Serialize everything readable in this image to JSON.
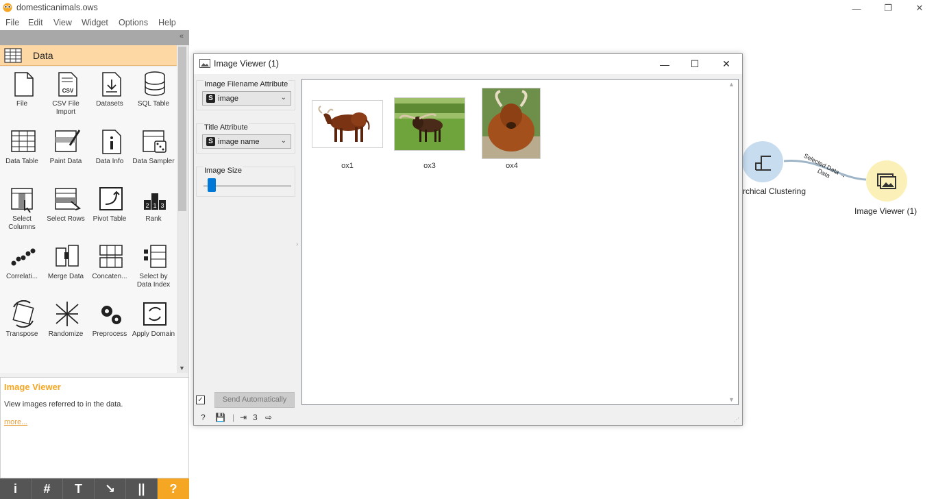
{
  "app": {
    "window_title": "domesticanimals.ows",
    "menu": [
      "File",
      "Edit",
      "View",
      "Widget",
      "Options",
      "Help"
    ]
  },
  "sidebar": {
    "category": "Data",
    "collapse_glyph": "«",
    "widgets": [
      {
        "label": "File",
        "icon": "file-icon"
      },
      {
        "label": "CSV File Import",
        "icon": "csv-file-icon"
      },
      {
        "label": "Datasets",
        "icon": "datasets-icon"
      },
      {
        "label": "SQL Table",
        "icon": "sql-table-icon"
      },
      {
        "label": "Data Table",
        "icon": "data-table-icon"
      },
      {
        "label": "Paint Data",
        "icon": "paint-data-icon"
      },
      {
        "label": "Data Info",
        "icon": "data-info-icon"
      },
      {
        "label": "Data Sampler",
        "icon": "data-sampler-icon"
      },
      {
        "label": "Select Columns",
        "icon": "select-columns-icon"
      },
      {
        "label": "Select Rows",
        "icon": "select-rows-icon"
      },
      {
        "label": "Pivot Table",
        "icon": "pivot-table-icon"
      },
      {
        "label": "Rank",
        "icon": "rank-icon"
      },
      {
        "label": "Correlati...",
        "icon": "correlations-icon"
      },
      {
        "label": "Merge Data",
        "icon": "merge-data-icon"
      },
      {
        "label": "Concaten...",
        "icon": "concatenate-icon"
      },
      {
        "label": "Select by Data Index",
        "icon": "select-by-data-index-icon"
      },
      {
        "label": "Transpose",
        "icon": "transpose-icon"
      },
      {
        "label": "Randomize",
        "icon": "randomize-icon"
      },
      {
        "label": "Preprocess",
        "icon": "preprocess-icon"
      },
      {
        "label": "Apply Domain",
        "icon": "apply-domain-icon"
      }
    ]
  },
  "help_panel": {
    "title": "Image Viewer",
    "description": "View images referred to in the data.",
    "more_link": "more..."
  },
  "bottom_toolbar": {
    "buttons": [
      {
        "glyph": "i",
        "icon": "info-icon"
      },
      {
        "glyph": "#",
        "icon": "grid-icon"
      },
      {
        "glyph": "T",
        "icon": "text-icon"
      },
      {
        "glyph": "↘",
        "icon": "arrow-icon"
      },
      {
        "glyph": "||",
        "icon": "pause-icon"
      },
      {
        "glyph": "?",
        "icon": "help-icon"
      }
    ]
  },
  "dialog": {
    "title": "Image Viewer (1)",
    "filename_attr": {
      "label": "Image Filename Attribute",
      "badge": "S",
      "value": "image"
    },
    "title_attr": {
      "label": "Title Attribute",
      "badge": "S",
      "value": "image name"
    },
    "image_size": {
      "label": "Image Size",
      "level_fraction": 0.05
    },
    "send_auto": {
      "checked": true,
      "check_glyph": "✓",
      "label": "Send Automatically"
    },
    "status": {
      "input_count": "3"
    },
    "images": [
      {
        "title": "ox1"
      },
      {
        "title": "ox3"
      },
      {
        "title": "ox4"
      }
    ]
  },
  "canvas": {
    "nodes": [
      {
        "label": "rchical Clustering",
        "icon": "hierarchical-clustering-icon"
      },
      {
        "label": "Image Viewer (1)",
        "icon": "image-viewer-icon"
      }
    ],
    "link": {
      "label_top": "Selected Data",
      "arrow": "→",
      "label_bottom": "Data"
    }
  },
  "colors": {
    "category_header": "#fdd8a5",
    "help_title": "#f5a623",
    "slider": "#0078d7",
    "clustering_node": "#c7dcef",
    "viewer_node": "#fbf1b8"
  }
}
